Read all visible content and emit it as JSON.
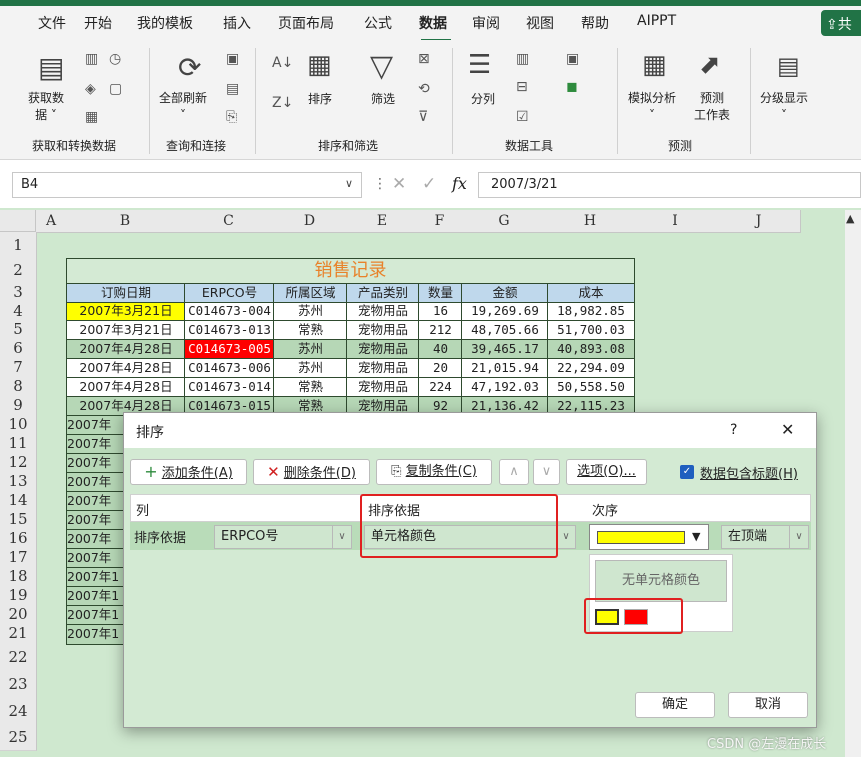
{
  "tabs": [
    "文件",
    "开始",
    "我的模板",
    "插入",
    "页面布局",
    "公式",
    "数据",
    "审阅",
    "视图",
    "帮助",
    "AIPPT"
  ],
  "active_tab": "数据",
  "share_label": "共",
  "ribbon": {
    "get_data": "获取数\n据 ˅",
    "refresh_all": "全部刷新\n˅",
    "sort": "排序",
    "filter": "筛选",
    "text_to_columns": "分列",
    "what_if": "模拟分析\n˅",
    "forecast": "预测\n工作表",
    "outline": "分级显示\n˅",
    "groups": [
      "获取和转换数据",
      "查询和连接",
      "排序和筛选",
      "数据工具",
      "预测"
    ]
  },
  "formula_bar": {
    "name_box": "B4",
    "fx": "fx",
    "value": "2007/3/21"
  },
  "columns": [
    "A",
    "B",
    "C",
    "D",
    "E",
    "F",
    "G",
    "H",
    "I",
    "J"
  ],
  "rows": [
    "1",
    "2",
    "3",
    "4",
    "5",
    "6",
    "7",
    "8",
    "9",
    "10",
    "11",
    "12",
    "13",
    "14",
    "15",
    "16",
    "17",
    "18",
    "19",
    "20",
    "21",
    "22",
    "23",
    "24",
    "25"
  ],
  "table": {
    "title": "销售记录",
    "headers": [
      "订购日期",
      "ERPCO号",
      "所属区域",
      "产品类别",
      "数量",
      "金额",
      "成本"
    ],
    "rows": [
      [
        "2007年3月21日",
        "C014673-004",
        "苏州",
        "宠物用品",
        "16",
        "19,269.69",
        "18,982.85"
      ],
      [
        "2007年3月21日",
        "C014673-013",
        "常熟",
        "宠物用品",
        "212",
        "48,705.66",
        "51,700.03"
      ],
      [
        "2007年4月28日",
        "C014673-005",
        "苏州",
        "宠物用品",
        "40",
        "39,465.17",
        "40,893.08"
      ],
      [
        "2007年4月28日",
        "C014673-006",
        "苏州",
        "宠物用品",
        "20",
        "21,015.94",
        "22,294.09"
      ],
      [
        "2007年4月28日",
        "C014673-014",
        "常熟",
        "宠物用品",
        "224",
        "47,192.03",
        "50,558.50"
      ],
      [
        "2007年4月28日",
        "C014673-015",
        "常熟",
        "宠物用品",
        "92",
        "21,136.42",
        "22,115.23"
      ]
    ],
    "partial_rows": [
      "2007年",
      "2007年",
      "2007年",
      "2007年",
      "2007年",
      "2007年",
      "2007年",
      "2007年",
      "2007年1",
      "2007年1",
      "2007年1",
      "2007年1"
    ]
  },
  "dialog": {
    "title": "排序",
    "help": "?",
    "close": "✕",
    "add_condition": "添加条件(A)",
    "delete_condition": "删除条件(D)",
    "copy_condition": "复制条件(C)",
    "options": "选项(O)...",
    "has_header": "数据包含标题(H)",
    "col_header": "列",
    "sort_on_header": "排序依据",
    "order_header": "次序",
    "row_label": "排序依据",
    "column_value": "ERPCO号",
    "sort_on_value": "单元格颜色",
    "position_value": "在顶端",
    "no_cell_color": "无单元格颜色",
    "ok": "确定",
    "cancel": "取消"
  },
  "colors": {
    "yellow": "#ffff00",
    "red": "#ff0000",
    "excel_green": "#217346"
  },
  "watermark": "CSDN @左漫在成长"
}
